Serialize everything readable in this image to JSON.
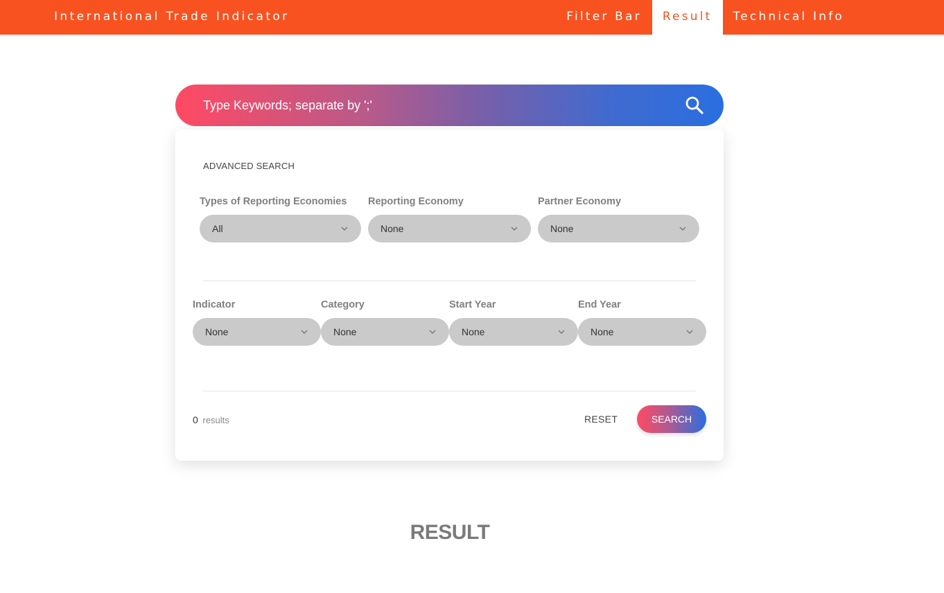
{
  "header": {
    "brand": "International Trade Indicator",
    "nav": [
      "Filter Bar",
      "Result",
      "Technical Info"
    ],
    "active_nav": "Result"
  },
  "search": {
    "placeholder": "Type Keywords; separate by ';'"
  },
  "advanced": {
    "title": "ADVANCED SEARCH",
    "row1": [
      {
        "label": "Types of Reporting Economies",
        "value": "All"
      },
      {
        "label": "Reporting Economy",
        "value": "None"
      },
      {
        "label": "Partner Economy",
        "value": "None"
      }
    ],
    "row2": [
      {
        "label": "Indicator",
        "value": "None"
      },
      {
        "label": "Category",
        "value": "None"
      },
      {
        "label": "Start Year",
        "value": "None"
      },
      {
        "label": "End Year",
        "value": "None"
      }
    ]
  },
  "footer": {
    "results_count": "0",
    "results_label": "results",
    "reset_label": "RESET",
    "search_label": "SEARCH"
  },
  "result": {
    "heading": "RESULT"
  },
  "colors": {
    "accent": "#f75220",
    "gradient_start": "#ff4a63",
    "gradient_end": "#2a6ee0",
    "select_bg": "#cacaca"
  }
}
